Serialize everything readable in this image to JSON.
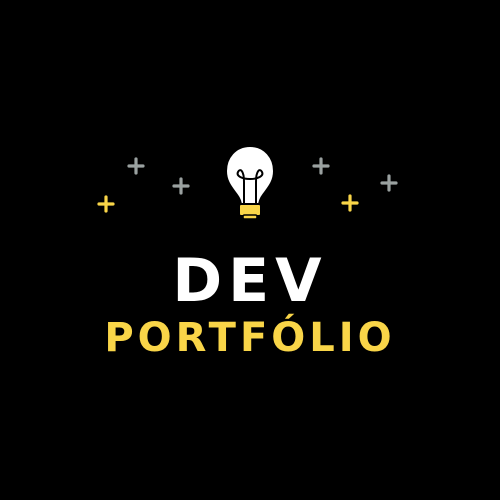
{
  "logo": {
    "line1": "DEV",
    "line2": "PORTFÓLIO",
    "icon": "lightbulb-icon",
    "colors": {
      "background": "#000000",
      "line1": "#ffffff",
      "line2": "#f9d548",
      "sparkle_gray": "#9aa1a0",
      "sparkle_yellow": "#f9d548",
      "bulb_outline": "#000000",
      "bulb_base": "#f9d548"
    }
  }
}
